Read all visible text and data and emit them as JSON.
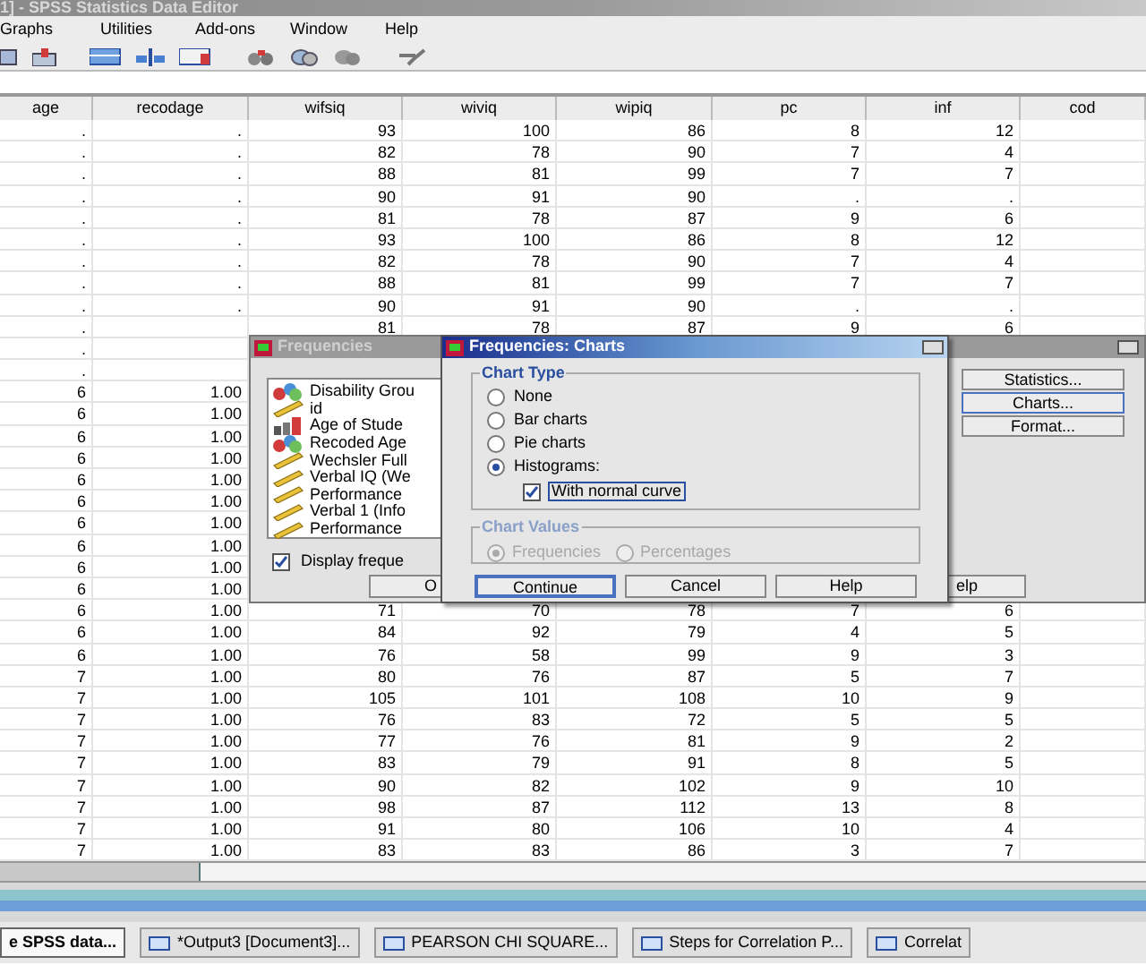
{
  "window": {
    "title": "1] - SPSS Statistics Data Editor"
  },
  "menu": [
    "Graphs",
    "Utilities",
    "Add-ons",
    "Window",
    "Help"
  ],
  "grid": {
    "columns": [
      "age",
      "recodage",
      "wifsiq",
      "wiviq",
      "wipiq",
      "pc",
      "inf",
      "cod"
    ],
    "rows": [
      {
        "cells": [
          ".",
          ".",
          "93",
          "100",
          "86",
          "8",
          "12"
        ]
      },
      {
        "cells": [
          ".",
          ".",
          "82",
          "78",
          "90",
          "7",
          "4"
        ]
      },
      {
        "cells": [
          ".",
          ".",
          "88",
          "81",
          "99",
          "7",
          "7"
        ]
      },
      {
        "cells": [
          ".",
          ".",
          "90",
          "91",
          "90",
          ".",
          "."
        ]
      },
      {
        "cells": [
          ".",
          ".",
          "81",
          "78",
          "87",
          "9",
          "6"
        ]
      },
      {
        "cells": [
          ".",
          ".",
          "93",
          "100",
          "86",
          "8",
          "12"
        ]
      },
      {
        "cells": [
          ".",
          ".",
          "82",
          "78",
          "90",
          "7",
          "4"
        ]
      },
      {
        "cells": [
          ".",
          ".",
          "88",
          "81",
          "99",
          "7",
          "7"
        ]
      },
      {
        "cells": [
          ".",
          ".",
          "90",
          "91",
          "90",
          ".",
          "."
        ]
      },
      {
        "cells": [
          ".",
          null,
          "81",
          "78",
          "87",
          "9",
          "6"
        ]
      },
      {
        "cells": [
          "."
        ]
      },
      {
        "cells": [
          "."
        ]
      },
      {
        "cells": [
          "6",
          "1.00"
        ]
      },
      {
        "cells": [
          "6",
          "1.00"
        ]
      },
      {
        "cells": [
          "6",
          "1.00"
        ]
      },
      {
        "cells": [
          "6",
          "1.00"
        ]
      },
      {
        "cells": [
          "6",
          "1.00"
        ]
      },
      {
        "cells": [
          "6",
          "1.00"
        ]
      },
      {
        "cells": [
          "6",
          "1.00"
        ]
      },
      {
        "cells": [
          "6",
          "1.00"
        ]
      },
      {
        "cells": [
          "6",
          "1.00"
        ]
      },
      {
        "cells": [
          "6",
          "1.00"
        ]
      },
      {
        "cells": [
          "6",
          "1.00",
          "71",
          "70",
          "78",
          "7",
          "6"
        ]
      },
      {
        "cells": [
          "6",
          "1.00",
          "84",
          "92",
          "79",
          "4",
          "5"
        ]
      },
      {
        "cells": [
          "6",
          "1.00",
          "76",
          "58",
          "99",
          "9",
          "3"
        ]
      },
      {
        "cells": [
          "7",
          "1.00",
          "80",
          "76",
          "87",
          "5",
          "7"
        ]
      },
      {
        "cells": [
          "7",
          "1.00",
          "105",
          "101",
          "108",
          "10",
          "9"
        ]
      },
      {
        "cells": [
          "7",
          "1.00",
          "76",
          "83",
          "72",
          "5",
          "5"
        ]
      },
      {
        "cells": [
          "7",
          "1.00",
          "77",
          "76",
          "81",
          "9",
          "2"
        ]
      },
      {
        "cells": [
          "7",
          "1.00",
          "83",
          "79",
          "91",
          "8",
          "5"
        ]
      },
      {
        "cells": [
          "7",
          "1.00",
          "90",
          "82",
          "102",
          "9",
          "10"
        ]
      },
      {
        "cells": [
          "7",
          "1.00",
          "98",
          "87",
          "112",
          "13",
          "8"
        ]
      },
      {
        "cells": [
          "7",
          "1.00",
          "91",
          "80",
          "106",
          "10",
          "4"
        ]
      },
      {
        "cells": [
          "7",
          "1.00",
          "83",
          "83",
          "86",
          "3",
          "7"
        ]
      }
    ]
  },
  "frequencies_dialog": {
    "title": "Frequencies",
    "variables": [
      {
        "label": "Disability Grou",
        "kind": "nominal"
      },
      {
        "label": "id",
        "kind": "scale"
      },
      {
        "label": "Age of Stude",
        "kind": "ordinal"
      },
      {
        "label": "Recoded Age",
        "kind": "nominal"
      },
      {
        "label": "Wechsler Full",
        "kind": "scale"
      },
      {
        "label": "Verbal IQ (We",
        "kind": "scale"
      },
      {
        "label": "Performance",
        "kind": "scale"
      },
      {
        "label": "Verbal 1 (Info",
        "kind": "scale"
      },
      {
        "label": "Performance",
        "kind": "scale"
      }
    ],
    "display_tables": {
      "label": "Display freque",
      "checked": true
    },
    "side_buttons": [
      {
        "label": "Statistics...",
        "focused": false
      },
      {
        "label": "Charts...",
        "focused": true
      },
      {
        "label": "Format...",
        "focused": false
      }
    ],
    "bottom_buttons": [
      {
        "label": "O"
      },
      {
        "label": "elp"
      }
    ]
  },
  "charts_dialog": {
    "title": "Frequencies: Charts",
    "chart_type": {
      "title": "Chart Type",
      "options": [
        {
          "label": "None",
          "selected": false
        },
        {
          "label": "Bar charts",
          "selected": false
        },
        {
          "label": "Pie charts",
          "selected": false
        },
        {
          "label": "Histograms:",
          "selected": true
        }
      ]
    },
    "normal_curve": {
      "label": "With normal curve",
      "checked": true
    },
    "chart_values": {
      "title": "Chart Values",
      "disabled": true,
      "options": [
        {
          "label": "Frequencies",
          "selected": true
        },
        {
          "label": "Percentages",
          "selected": false
        }
      ]
    },
    "buttons": [
      {
        "label": "Continue",
        "focused": true
      },
      {
        "label": "Cancel",
        "focused": false
      },
      {
        "label": "Help",
        "focused": false
      }
    ]
  },
  "taskbar": [
    {
      "label": "e SPSS data...",
      "selected": true
    },
    {
      "label": "*Output3 [Document3]...",
      "selected": false
    },
    {
      "label": "PEARSON CHI SQUARE...",
      "selected": false
    },
    {
      "label": "Steps for Correlation P...",
      "selected": false
    },
    {
      "label": "Correlat",
      "selected": false
    }
  ]
}
